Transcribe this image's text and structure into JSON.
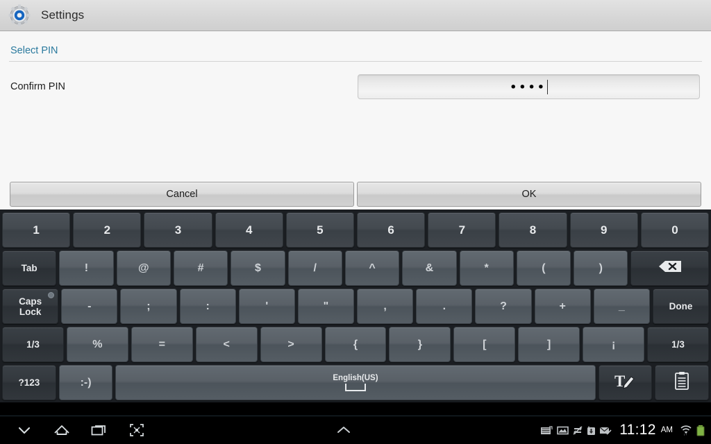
{
  "titlebar": {
    "app_title": "Settings",
    "icon": "settings-gear-icon"
  },
  "content": {
    "section_header": "Select PIN",
    "field_label": "Confirm PIN",
    "pin_value": "••••",
    "pin_char_count": 4
  },
  "dialog_buttons": {
    "cancel": "Cancel",
    "ok": "OK"
  },
  "keyboard": {
    "rows": [
      {
        "name": "number-row",
        "keys": [
          {
            "label": "1",
            "style": "num"
          },
          {
            "label": "2",
            "style": "num"
          },
          {
            "label": "3",
            "style": "num"
          },
          {
            "label": "4",
            "style": "num"
          },
          {
            "label": "5",
            "style": "num"
          },
          {
            "label": "6",
            "style": "num"
          },
          {
            "label": "7",
            "style": "num"
          },
          {
            "label": "8",
            "style": "num"
          },
          {
            "label": "9",
            "style": "num"
          },
          {
            "label": "0",
            "style": "num"
          }
        ]
      },
      {
        "name": "symbol-row-1",
        "keys": [
          {
            "label": "Tab",
            "style": "dark",
            "size": "small"
          },
          {
            "label": "!",
            "style": "sym"
          },
          {
            "label": "@",
            "style": "sym"
          },
          {
            "label": "#",
            "style": "sym"
          },
          {
            "label": "$",
            "style": "sym"
          },
          {
            "label": "/",
            "style": "sym"
          },
          {
            "label": "^",
            "style": "sym"
          },
          {
            "label": "&",
            "style": "sym"
          },
          {
            "label": "*",
            "style": "sym"
          },
          {
            "label": "(",
            "style": "sym"
          },
          {
            "label": ")",
            "style": "sym"
          },
          {
            "label": "",
            "style": "dark",
            "icon": "backspace-icon"
          }
        ]
      },
      {
        "name": "symbol-row-2",
        "keys": [
          {
            "label": "Caps\nLock",
            "style": "dark",
            "icon": "caps-lock-led"
          },
          {
            "label": "-",
            "style": "sym"
          },
          {
            "label": ";",
            "style": "sym"
          },
          {
            "label": ":",
            "style": "sym"
          },
          {
            "label": "'",
            "style": "sym"
          },
          {
            "label": "\"",
            "style": "sym"
          },
          {
            "label": ",",
            "style": "sym"
          },
          {
            "label": ".",
            "style": "sym"
          },
          {
            "label": "?",
            "style": "sym"
          },
          {
            "label": "+",
            "style": "sym"
          },
          {
            "label": "_",
            "style": "sym"
          },
          {
            "label": "Done",
            "style": "dark",
            "size": "small"
          }
        ]
      },
      {
        "name": "symbol-row-3",
        "keys": [
          {
            "label": "1/3",
            "style": "dark",
            "size": "small"
          },
          {
            "label": "%",
            "style": "sym"
          },
          {
            "label": "=",
            "style": "sym"
          },
          {
            "label": "<",
            "style": "sym"
          },
          {
            "label": ">",
            "style": "sym"
          },
          {
            "label": "{",
            "style": "sym"
          },
          {
            "label": "}",
            "style": "sym"
          },
          {
            "label": "[",
            "style": "sym"
          },
          {
            "label": "]",
            "style": "sym"
          },
          {
            "label": "¡",
            "style": "sym"
          },
          {
            "label": "1/3",
            "style": "dark",
            "size": "small"
          }
        ]
      },
      {
        "name": "bottom-row",
        "keys": [
          {
            "label": "?123",
            "style": "dark",
            "size": "small"
          },
          {
            "label": ":-)",
            "style": "sym"
          },
          {
            "label": "English(US)",
            "style": "space"
          },
          {
            "label": "",
            "style": "dark",
            "icon": "handwriting-icon"
          },
          {
            "label": "",
            "style": "dark",
            "icon": "clipboard-icon"
          }
        ]
      }
    ]
  },
  "navbar": {
    "back": "back-icon",
    "home": "home-icon",
    "recents": "recent-apps-icon",
    "screenshot": "screen-capture-icon",
    "expand": "expand-up-icon"
  },
  "statusbar": {
    "time": "11:12",
    "meridiem": "AM",
    "icons": [
      "keyboard-icon",
      "image-icon",
      "sync-disabled-icon",
      "download-icon",
      "mail-icon",
      "wifi-icon",
      "battery-icon"
    ],
    "battery_color": "#8bc34a"
  }
}
